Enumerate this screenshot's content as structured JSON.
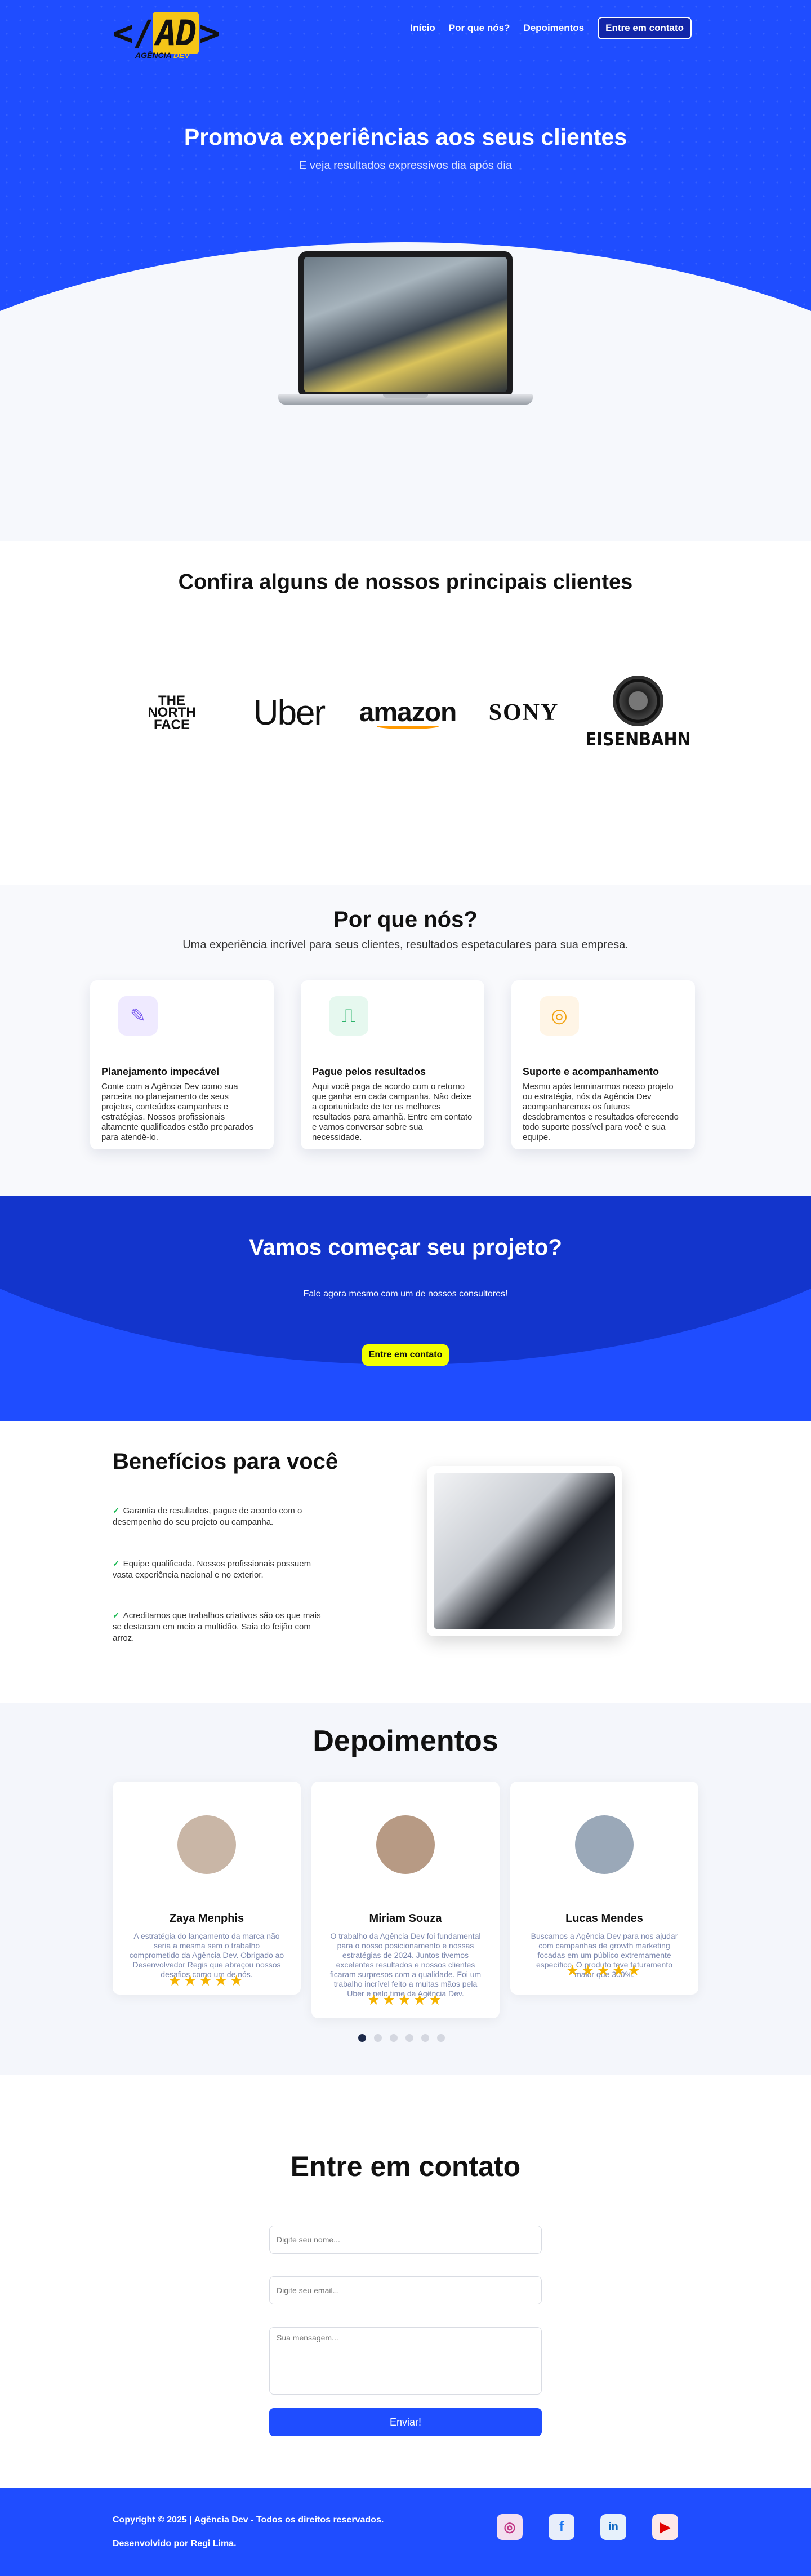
{
  "header": {
    "logo_mark_left": "</",
    "logo_mark_ad": "AD",
    "logo_mark_right": ">",
    "logo_sub_a": "AGÊNCIA",
    "logo_sub_b": "DEV",
    "nav": [
      "Início",
      "Por que nós?",
      "Depoimentos",
      "Entre em contato"
    ]
  },
  "hero": {
    "title": "Promova experiências aos seus clientes",
    "subtitle": "E veja resultados expressivos dia após dia"
  },
  "clients": {
    "title": "Confira alguns de nossos principais clientes",
    "tnf": [
      "THE",
      "NORTH",
      "FACE"
    ],
    "uber": "Uber",
    "amazon": "amazon",
    "sony": "SONY",
    "eisenbahn": "EISENBAHN"
  },
  "why": {
    "title": "Por que nós?",
    "subtitle": "Uma experiência incrível para seus clientes, resultados espetaculares para sua empresa.",
    "cards": [
      {
        "title": "Planejamento impecável",
        "text": "Conte com a Agência Dev como sua parceira no planejamento de seus projetos, conteúdos campanhas e estratégias. Nossos profissionais altamente qualificados estão preparados para atendê-lo.",
        "icon": "clipboard-edit-icon",
        "bg": "#efeaff",
        "fg": "#7b5cf0"
      },
      {
        "title": "Pague pelos resultados",
        "text": "Aqui você paga de acordo com o retorno que ganha em cada campanha. Não deixe a oportunidade de ter os melhores resultados para amanhã. Entre em contato e vamos conversar sobre sua necessidade.",
        "icon": "chart-monitor-icon",
        "bg": "#e6f8ef",
        "fg": "#2db36b"
      },
      {
        "title": "Suporte e acompanhamento",
        "text": "Mesmo após terminarmos nosso projeto ou estratégia, nós da Agência Dev acompanharemos os futuros desdobramentos e resultados oferecendo todo suporte possível para você e sua equipe.",
        "icon": "lifebuoy-icon",
        "bg": "#fff5e6",
        "fg": "#f2a516"
      }
    ]
  },
  "cta": {
    "title": "Vamos começar seu projeto?",
    "subtitle": "Fale agora mesmo com um de nossos consultores!",
    "button": "Entre em contato"
  },
  "benefits": {
    "title": "Benefícios para você",
    "items": [
      "Garantia de resultados, pague de acordo com o desempenho do seu projeto ou campanha.",
      "Equipe qualificada. Nossos profissionais possuem vasta experiência nacional e no exterior.",
      "Acreditamos que trabalhos criativos são os que mais se destacam em meio a multidão. Saia do feijão com arroz."
    ]
  },
  "testimonials": {
    "title": "Depoimentos",
    "items": [
      {
        "name": "Zaya Menphis",
        "text": "A estratégia do lançamento da marca não seria a mesma sem o trabalho comprometido da Agência Dev. Obrigado ao Desenvolvedor Regis que abraçou nossos desafios como um de nós.",
        "stars": 5,
        "avatar_bg": "#c9b6a6"
      },
      {
        "name": "Miriam Souza",
        "text": "O trabalho da Agência Dev foi fundamental para o nosso posicionamento e nossas estratégias de 2024. Juntos tivemos excelentes resultados e nossos clientes ficaram surpresos com a qualidade. Foi um trabalho incrível feito a muitas mãos pela Uber e pelo time da Agência Dev.",
        "stars": 5,
        "avatar_bg": "#b79a84"
      },
      {
        "name": "Lucas Mendes",
        "text": "Buscamos a Agência Dev para nos ajudar com campanhas de growth marketing focadas em um público extremamente específico. O produto teve faturamento maior que 300%.",
        "stars": 5,
        "avatar_bg": "#9aa8b8"
      }
    ],
    "slides": 6,
    "active_slide": 1
  },
  "contact": {
    "title": "Entre em contato",
    "name_placeholder": "Digite seu nome...",
    "email_placeholder": "Digite seu email...",
    "message_placeholder": "Sua mensagem...",
    "submit": "Enviar!"
  },
  "footer": {
    "copyright": "Copyright © 2025 | Agência Dev - Todos os direitos reservados.",
    "credit": "Desenvolvido por Regi Lima.",
    "social": [
      {
        "name": "instagram-icon",
        "glyph": "◎",
        "bg": "#f3dff0",
        "fg": "#c13584"
      },
      {
        "name": "facebook-icon",
        "glyph": "f",
        "bg": "#e8eefb",
        "fg": "#1877f2"
      },
      {
        "name": "linkedin-icon",
        "glyph": "in",
        "bg": "#e6f1fb",
        "fg": "#0a66c2"
      },
      {
        "name": "youtube-icon",
        "glyph": "▶",
        "bg": "#fde8e8",
        "fg": "#e00000"
      }
    ]
  }
}
